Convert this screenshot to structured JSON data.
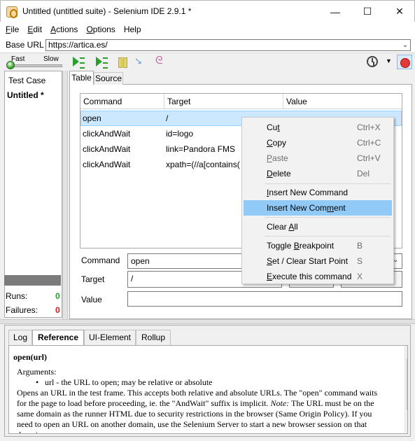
{
  "window": {
    "title": "Untitled (untitled suite) - Selenium IDE 2.9.1 *",
    "minimize_glyph": "—",
    "maximize_glyph": "☐",
    "close_glyph": "✕"
  },
  "menubar": {
    "items": [
      {
        "label": "File",
        "accel": "F",
        "rest": "ile"
      },
      {
        "label": "Edit",
        "accel": "E",
        "rest": "dit"
      },
      {
        "label": "Actions",
        "accel": "A",
        "rest": "ctions"
      },
      {
        "label": "Options",
        "accel": "O",
        "rest": "ptions"
      },
      {
        "label": "Help",
        "accel": "",
        "rest": "Help"
      }
    ]
  },
  "base_url": {
    "label": "Base URL",
    "value": "https://artica.es/"
  },
  "toolbar": {
    "speed_fast": "Fast",
    "speed_slow": "Slow",
    "icons": [
      "play-suite-icon",
      "play-test-icon",
      "pause-icon",
      "step-icon",
      "rollup-icon",
      "clock-icon",
      "record-icon"
    ]
  },
  "left_panel": {
    "header": "Test Case",
    "items": [
      "Untitled *"
    ],
    "runs_label": "Runs:",
    "runs_value": "0",
    "failures_label": "Failures:",
    "failures_value": "0"
  },
  "editor": {
    "tabs": [
      "Table",
      "Source"
    ],
    "columns": [
      "Command",
      "Target",
      "Value"
    ],
    "rows": [
      {
        "command": "open",
        "target": "/",
        "value": ""
      },
      {
        "command": "clickAndWait",
        "target": "id=logo",
        "value": ""
      },
      {
        "command": "clickAndWait",
        "target": "link=Pandora FMS",
        "value": ""
      },
      {
        "command": "clickAndWait",
        "target": "xpath=(//a[contains(",
        "value": ""
      }
    ],
    "command_label": "Command",
    "command_value": "open",
    "target_label": "Target",
    "target_value": "/",
    "value_label": "Value",
    "value_value": ""
  },
  "context_menu": {
    "groups": [
      [
        {
          "label": "Cut",
          "accel_index": 2,
          "key": "Ctrl+X",
          "disabled": false
        },
        {
          "label": "Copy",
          "accel_index": 0,
          "key": "Ctrl+C",
          "disabled": false
        },
        {
          "label": "Paste",
          "accel_index": 0,
          "key": "Ctrl+V",
          "disabled": true
        },
        {
          "label": "Delete",
          "accel_index": 0,
          "key": "Del",
          "disabled": false
        }
      ],
      [
        {
          "label": "Insert New Command",
          "accel_index": 0,
          "key": "",
          "disabled": false
        },
        {
          "label": "Insert New Comment",
          "accel_index": 14,
          "key": "",
          "disabled": false,
          "highlighted": true
        }
      ],
      [
        {
          "label": "Clear All",
          "accel_index": 6,
          "key": "",
          "disabled": false
        }
      ],
      [
        {
          "label": "Toggle Breakpoint",
          "accel_index": 7,
          "key": "B",
          "disabled": false
        },
        {
          "label": "Set / Clear Start Point",
          "accel_index": 0,
          "key": "S",
          "disabled": false
        },
        {
          "label": "Execute this command",
          "accel_index": 0,
          "key": "X",
          "disabled": false
        }
      ]
    ]
  },
  "bottom_panel": {
    "tabs": [
      "Log",
      "Reference",
      "UI-Element",
      "Rollup"
    ],
    "active_tab": "Reference",
    "reference": {
      "signature": "open(url)",
      "arguments_label": "Arguments:",
      "argument": "url - the URL to open; may be relative or absolute",
      "description_1": "Opens an URL in the test frame. This accepts both relative and absolute URLs. The \"open\" command waits for the page to load before proceeding, ie. the \"AndWait\" suffix is implicit.",
      "note_label": "Note:",
      "description_2": "The URL must be on the same domain as the runner HTML due to security restrictions in the browser (Same Origin Policy). If you need to open an URL on another domain, use the Selenium Server to start a new browser session on that domain."
    }
  },
  "colors": {
    "selection_row": "#cce8ff",
    "menu_highlight": "#91c9f7",
    "runs_green": "#2a9a2a",
    "failures_red": "#d02020"
  }
}
